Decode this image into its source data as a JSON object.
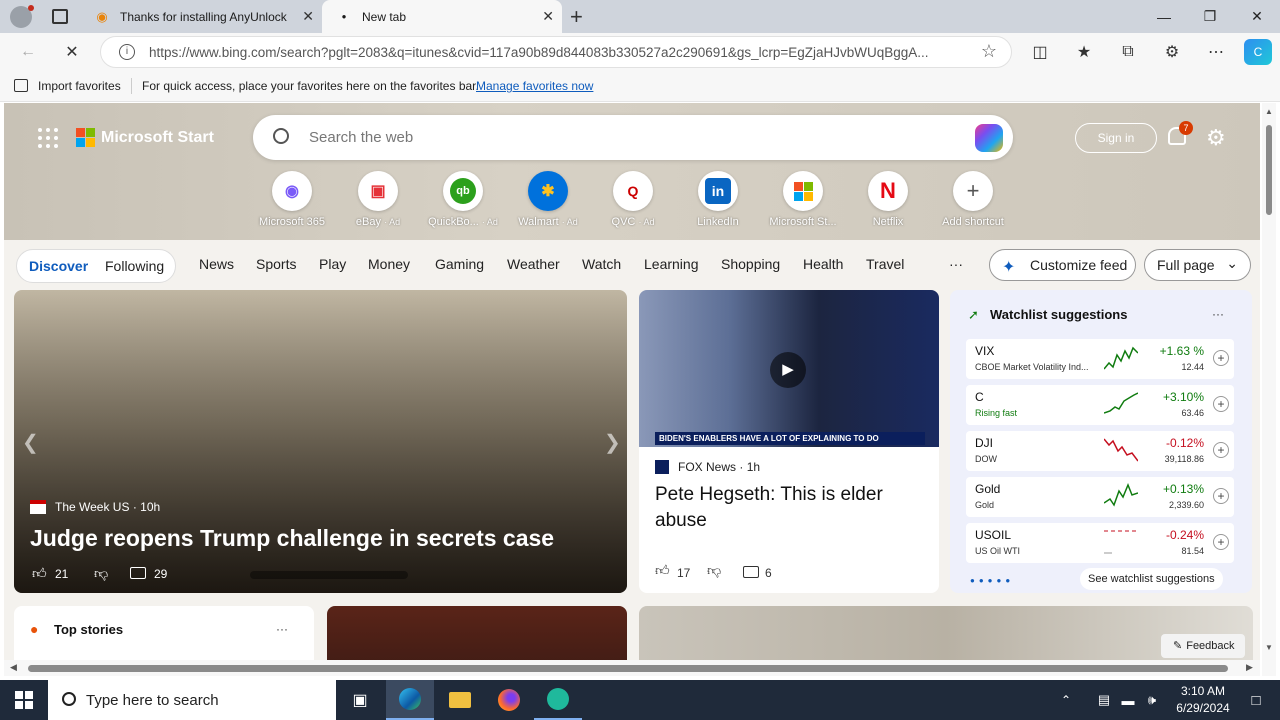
{
  "browser": {
    "tabs": [
      {
        "title": "Thanks for installing AnyUnlock"
      },
      {
        "title": "New tab"
      }
    ],
    "url": "https://www.bing.com/search?pglt=2083&q=itunes&cvid=117a90b89d844083b330527a2c290691&gs_lcrp=EgZjaHJvbWUqBggA...",
    "favorites": {
      "import_label": "Import favorites",
      "hint": "For quick access, place your favorites here on the favorites bar.",
      "manage_link": "Manage favorites now"
    }
  },
  "start": {
    "brand": "Microsoft Start",
    "search_placeholder": "Search the web",
    "sign_in": "Sign in",
    "notification_count": "7",
    "shortcuts": [
      {
        "label": "Microsoft 365",
        "ad": ""
      },
      {
        "label": "eBay",
        "ad": "· Ad"
      },
      {
        "label": "QuickBo...",
        "ad": "· Ad"
      },
      {
        "label": "Walmart",
        "ad": "· Ad"
      },
      {
        "label": "QVC",
        "ad": "· Ad"
      },
      {
        "label": "LinkedIn",
        "ad": ""
      },
      {
        "label": "Microsoft St...",
        "ad": ""
      },
      {
        "label": "Netflix",
        "ad": ""
      },
      {
        "label": "Add shortcut",
        "ad": ""
      }
    ],
    "nav": {
      "discover": "Discover",
      "following": "Following",
      "items": [
        "News",
        "Sports",
        "Play",
        "Money",
        "Gaming",
        "Weather",
        "Watch",
        "Learning",
        "Shopping",
        "Health",
        "Travel"
      ],
      "more": "···",
      "customize": "Customize feed",
      "layout": "Full page"
    }
  },
  "main_story": {
    "source": "The Week US",
    "age": "10h",
    "headline": "Judge reopens Trump challenge in secrets case",
    "likes": "21",
    "comments": "29"
  },
  "fox_story": {
    "source": "FOX News",
    "age": "1h",
    "headline": "Pete Hegseth: This is elder abuse",
    "likes": "17",
    "comments": "6",
    "chyron": "BIDEN'S ENABLERS HAVE A LOT OF EXPLAINING TO DO"
  },
  "watchlist": {
    "title": "Watchlist suggestions",
    "more": "···",
    "see_all": "See watchlist suggestions",
    "items": [
      {
        "symbol": "VIX",
        "name": "CBOE Market Volatility Ind...",
        "change": "+1.63 %",
        "value": "12.44",
        "trend": "up"
      },
      {
        "symbol": "C",
        "name": "Rising fast",
        "change": "+3.10%",
        "value": "63.46",
        "trend": "up"
      },
      {
        "symbol": "DJI",
        "name": "DOW",
        "change": "-0.12%",
        "value": "39,118.86",
        "trend": "down"
      },
      {
        "symbol": "Gold",
        "name": "Gold",
        "change": "+0.13%",
        "value": "2,339.60",
        "trend": "up"
      },
      {
        "symbol": "USOIL",
        "name": "US Oil WTI",
        "change": "-0.24%",
        "value": "81.54",
        "trend": "down"
      }
    ]
  },
  "top_stories": {
    "title": "Top stories",
    "more": "···"
  },
  "feedback": "Feedback",
  "taskbar": {
    "search_placeholder": "Type here to search",
    "time": "3:10 AM",
    "date": "6/29/2024"
  }
}
